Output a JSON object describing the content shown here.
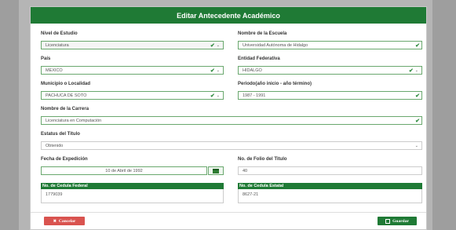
{
  "modal": {
    "title": "Editar Antecedente Académico"
  },
  "form": {
    "nivel": {
      "label": "Nivel de Estudio",
      "value": "Licenciatura"
    },
    "escuela": {
      "label": "Nombre de la Escuela",
      "value": "Universidad Autónoma de Hidalgo"
    },
    "pais": {
      "label": "País",
      "value": "MEXICO"
    },
    "entidad": {
      "label": "Entidad Federativa",
      "value": "HIDALGO"
    },
    "municipio": {
      "label": "Municipio o Localidad",
      "value": "PACHUCA DE SOTO"
    },
    "periodo": {
      "label": "Periodo(año inicio - año término)",
      "value": "1987 - 1991"
    },
    "carrera": {
      "label": "Nombre de la Carrera",
      "value": "Licenciatura en Computación"
    },
    "estatus": {
      "label": "Estatus del Titulo",
      "value": "Obtenido"
    },
    "fecha": {
      "label": "Fecha de Expedición",
      "value": "10 de Abril de 1992"
    },
    "folio": {
      "label": "No. de Folio del Titulo",
      "value": "40"
    },
    "cedula_federal": {
      "label": "No. de Cedula Federal",
      "value": "1779039"
    },
    "cedula_estatal": {
      "label": "No. de Cedula Estatal",
      "value": "8627-21"
    }
  },
  "footer": {
    "cancel_label": "Cancelar",
    "save_label": "Guardar"
  },
  "icons": {
    "check": "✔",
    "caret": "⌄",
    "times": "✖"
  },
  "colors": {
    "primary_green": "#1f7a35",
    "danger_red": "#d9534f",
    "valid_border": "#6aa86e"
  }
}
